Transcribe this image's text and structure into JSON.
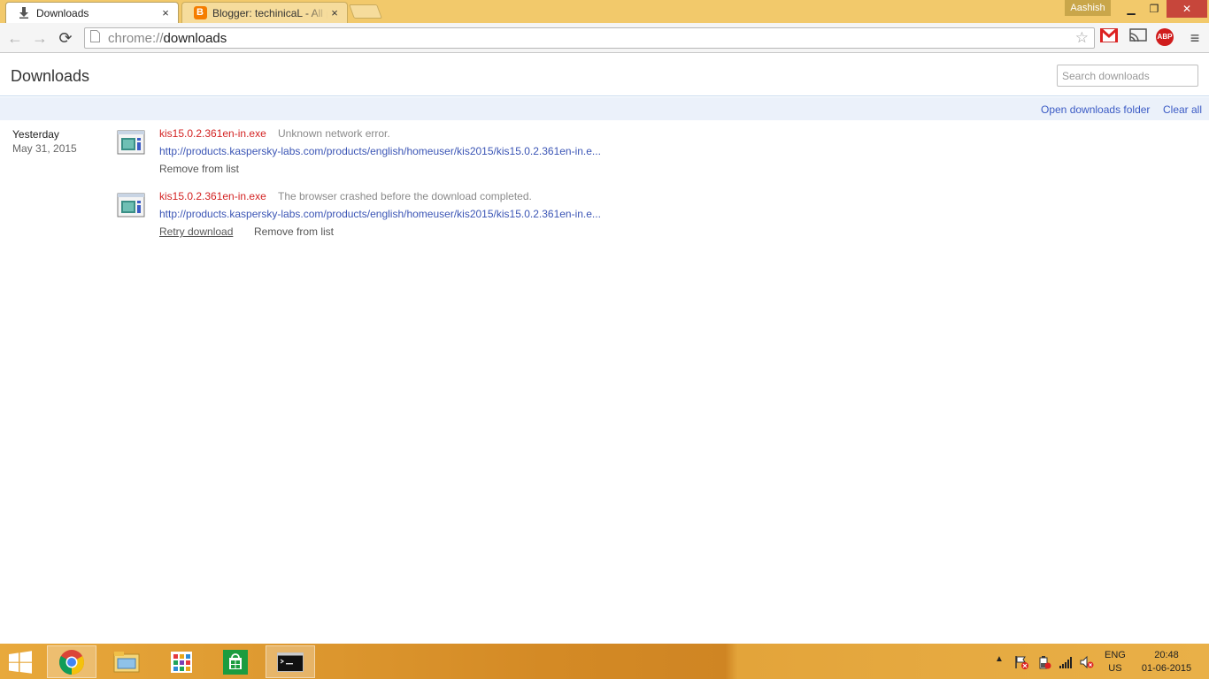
{
  "browser": {
    "tabs": [
      {
        "title": "Downloads",
        "close": "×"
      },
      {
        "title": "Blogger: techinicaL - All p",
        "close": "×"
      }
    ],
    "profile_name": "Aashish",
    "window_controls": {
      "minimize": "▁",
      "maximize": "❐",
      "close": "✕"
    },
    "nav": {
      "back": "←",
      "forward": "→",
      "reload": "⟳"
    },
    "omnibox": {
      "scheme": "chrome://",
      "host": "downloads"
    },
    "menu_glyph": "≡",
    "abp_label": "ABP"
  },
  "downloads": {
    "title": "Downloads",
    "search_placeholder": "Search downloads",
    "open_folder_link": "Open downloads folder",
    "clear_all_link": "Clear all",
    "date_group": {
      "since": "Yesterday",
      "date": "May 31, 2015"
    },
    "items": [
      {
        "file_name": "kis15.0.2.361en-in.exe",
        "status": "Unknown network error.",
        "url": "http://products.kaspersky-labs.com/products/english/homeuser/kis2015/kis15.0.2.361en-in.e...",
        "controls": [
          "Remove from list"
        ]
      },
      {
        "file_name": "kis15.0.2.361en-in.exe",
        "status": "The browser crashed before the download completed.",
        "url": "http://products.kaspersky-labs.com/products/english/homeuser/kis2015/kis15.0.2.361en-in.e...",
        "controls": [
          "Retry download",
          "Remove from list"
        ]
      }
    ]
  },
  "taskbar": {
    "language": {
      "line1": "ENG",
      "line2": "US"
    },
    "clock": {
      "time": "20:48",
      "date": "01-06-2015"
    },
    "tray_chevron": "▲"
  },
  "colors": {
    "titlebar": "#f2c96b",
    "link": "#3b5bc5",
    "error_filename": "#d32424",
    "summary_bar": "#ebf1fa"
  }
}
